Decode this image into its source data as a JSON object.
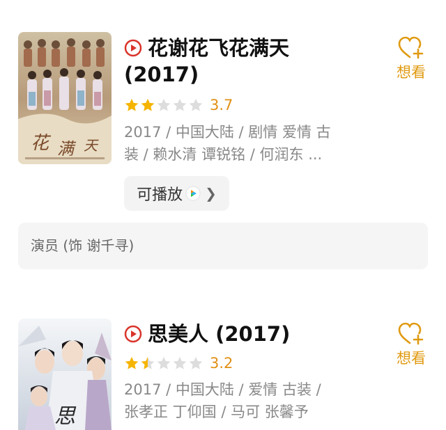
{
  "items": [
    {
      "title": "花谢花飞花满天",
      "year": "(2017)",
      "rating": 3.7,
      "stars_filled": 2,
      "meta_line1": "2017 / 中国大陆 / 剧情 爱情 古",
      "meta_line2": "装 / 赖水清 谭锐铭 / 何润东 ...",
      "playable_label": "可播放",
      "want_label": "想看",
      "role": "演员 (饰 谢千寻)"
    },
    {
      "title": "思美人 (2017)",
      "rating": 3.2,
      "stars_filled": 1.5,
      "meta_line1": "2017 / 中国大陆 / 爱情 古装 /",
      "meta_line2": "张孝正 丁仰国 / 马可 张馨予",
      "want_label": "想看"
    }
  ],
  "colors": {
    "accent": "#e09a10",
    "play_red": "#d9342b",
    "star_on": "#f5b400",
    "star_off": "#dddddd"
  }
}
